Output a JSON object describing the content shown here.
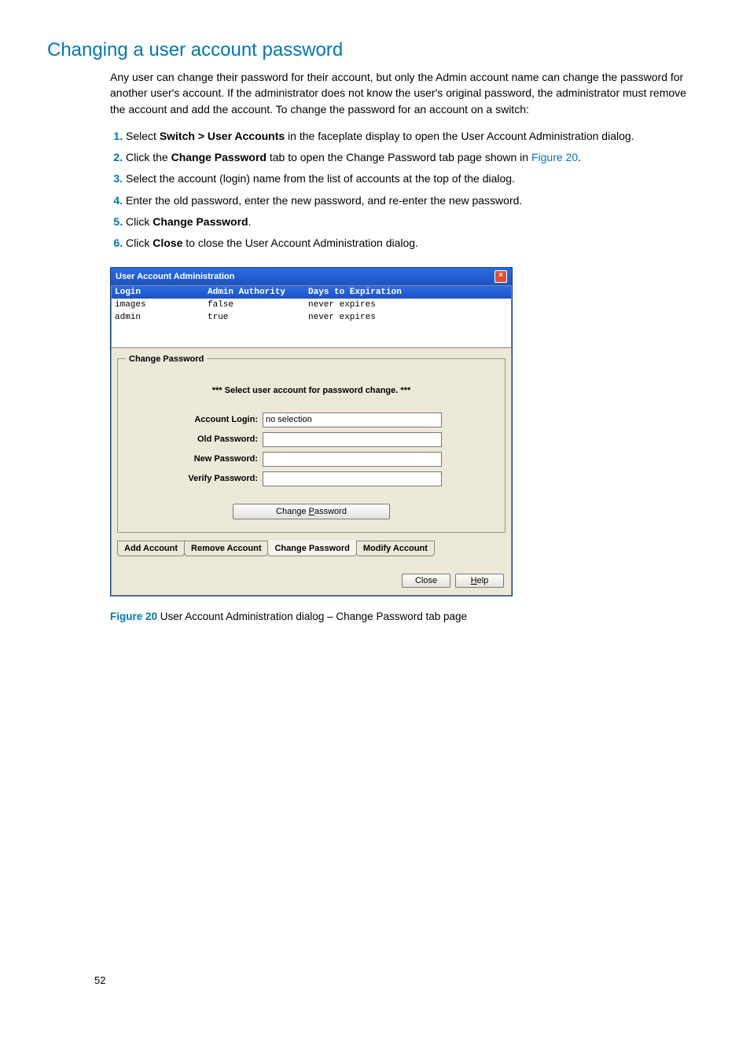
{
  "heading": "Changing a user account password",
  "intro": "Any user can change their password for their account, but only the Admin account name can change the password for another user's account. If the administrator does not know the user's original password, the administrator must remove the account and add the account. To change the password for an account on a switch:",
  "steps": {
    "s1a": "Select ",
    "s1b": "Switch > User Accounts",
    "s1c": " in the faceplate display to open the User Account Administration dialog.",
    "s2a": "Click the ",
    "s2b": "Change Password",
    "s2c": " tab to open the Change Password tab page shown in ",
    "s2link": "Figure 20",
    "s2d": ".",
    "s3": "Select the account (login) name from the list of accounts at the top of the dialog.",
    "s4": "Enter the old password, enter the new password, and re-enter the new password.",
    "s5a": "Click ",
    "s5b": "Change Password",
    "s5c": ".",
    "s6a": "Click ",
    "s6b": "Close",
    "s6c": " to close the User Account Administration dialog."
  },
  "dialog": {
    "title": "User Account Administration",
    "columns": {
      "c1": "Login",
      "c2": "Admin Authority",
      "c3": "Days to Expiration"
    },
    "rows": [
      {
        "login": "images",
        "auth": "false",
        "exp": "never expires"
      },
      {
        "login": "admin",
        "auth": "true",
        "exp": "never expires"
      }
    ],
    "panelLegend": "Change Password",
    "hint": "*** Select user account for password change. ***",
    "labels": {
      "account": "Account Login:",
      "old": "Old Password:",
      "newp": "New Password:",
      "verify": "Verify Password:"
    },
    "accountValue": "no selection",
    "cpBtnPre": "Change ",
    "cpBtnU": "P",
    "cpBtnPost": "assword",
    "tabs": {
      "add": "Add Account",
      "remove": "Remove Account",
      "change": "Change Password",
      "modify": "Modify Account"
    },
    "footer": {
      "close": "Close",
      "helpU": "H",
      "helpRest": "elp"
    }
  },
  "figure": {
    "num": "Figure 20",
    "caption": "  User Account Administration dialog – Change Password tab page"
  },
  "pageNumber": "52"
}
